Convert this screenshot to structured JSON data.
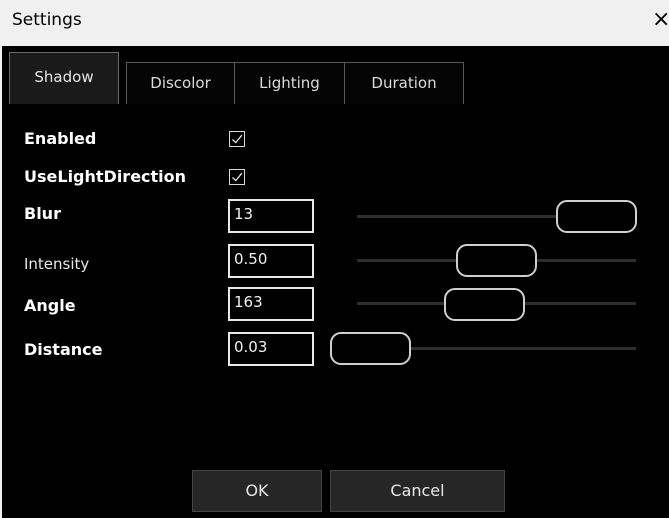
{
  "window": {
    "title": "Settings",
    "close_glyph": "×"
  },
  "tabs": [
    {
      "label": "Shadow",
      "active": true
    },
    {
      "label": "Discolor",
      "active": false
    },
    {
      "label": "Lighting",
      "active": false
    },
    {
      "label": "Duration",
      "active": false
    }
  ],
  "shadow": {
    "enabled": {
      "label": "Enabled",
      "checked": true
    },
    "use_light_direction": {
      "label": "UseLightDirection",
      "checked": true
    },
    "blur": {
      "label": "Blur",
      "value": "13"
    },
    "intensity": {
      "label": "Intensity",
      "value": "0.50"
    },
    "angle": {
      "label": "Angle",
      "value": "163"
    },
    "distance": {
      "label": "Distance",
      "value": "0.03"
    }
  },
  "buttons": {
    "ok": "OK",
    "cancel": "Cancel"
  },
  "icons": {
    "close": "close-icon",
    "check": "check-icon"
  },
  "colors": {
    "dialog_bg": "#000000",
    "titlebar_bg": "#f0f0f0",
    "text": "#ffffff"
  }
}
